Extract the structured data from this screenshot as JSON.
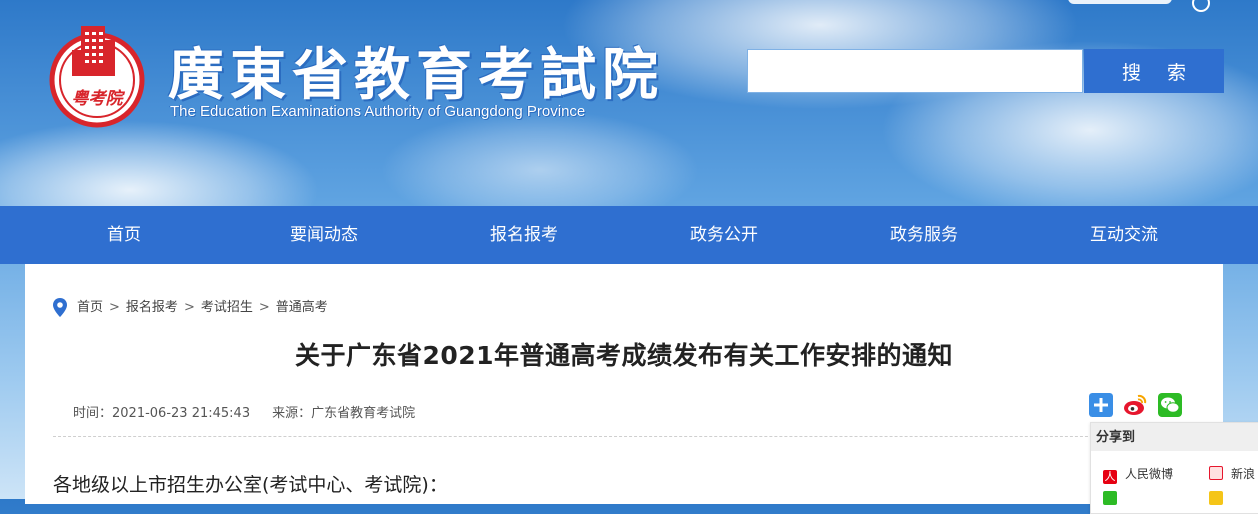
{
  "header": {
    "title_cn": "廣東省教育考試院",
    "title_en": "The Education Examinations Authority of Guangdong Province",
    "seal_text": "粤考院"
  },
  "search": {
    "placeholder": "",
    "button_label": "搜 索"
  },
  "nav": {
    "items": [
      {
        "label": "首页"
      },
      {
        "label": "要闻动态"
      },
      {
        "label": "报名报考"
      },
      {
        "label": "政务公开"
      },
      {
        "label": "政务服务"
      },
      {
        "label": "互动交流"
      }
    ]
  },
  "breadcrumb": {
    "items": [
      "首页",
      "报名报考",
      "考试招生",
      "普通高考"
    ],
    "separator": ">"
  },
  "article": {
    "title": "关于广东省2021年普通高考成绩发布有关工作安排的通知",
    "time_label": "时间：",
    "time_value": "2021-06-23 21:45:43",
    "source_label": "来源：",
    "source_value": "广东省教育考试院",
    "greeting": "各地级以上市招生办公室(考试中心、考试院)："
  },
  "share": {
    "icons": [
      "plus-share-icon",
      "weibo-icon",
      "wechat-icon"
    ],
    "panel_title": "分享到",
    "options": [
      "人民微博",
      "新浪"
    ]
  },
  "colors": {
    "brand_blue": "#2f6fd0",
    "seal_red": "#d8252b"
  }
}
